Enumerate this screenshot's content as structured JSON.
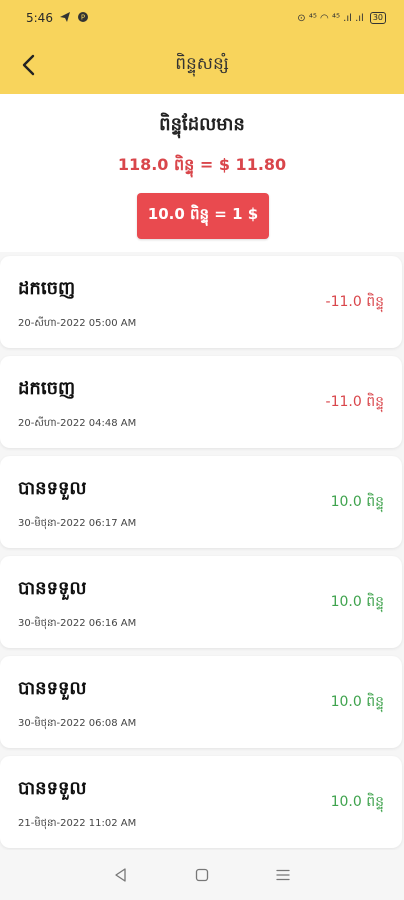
{
  "status_bar": {
    "time": "5:46",
    "left_glyphs": [
      "telegram-icon",
      "app-icon"
    ],
    "right_glyphs": "⊙ ⁴⁵ ◠ ⁴⁵ .ıl .ıl",
    "battery": "30"
  },
  "header": {
    "title": "ពិន្ទុសន្សំ",
    "back_icon": "arrow-left-icon"
  },
  "summary": {
    "label": "ពិន្ទុដែលមាន",
    "balance": "118.0 ពិន្ទុ = $ 11.80",
    "rate_button": "10.0 ពិន្ទុ = 1 $"
  },
  "colors": {
    "header_bg": "#f8d45c",
    "accent_red": "#e94a4f",
    "negative": "#d9464b",
    "positive": "#3fa34d"
  },
  "transactions": [
    {
      "title": "ដកចេញ",
      "date": "20-សីហា-2022  05:00 AM",
      "amount": "-11.0 ពិន្ទុ",
      "type": "out"
    },
    {
      "title": "ដកចេញ",
      "date": "20-សីហា-2022  04:48 AM",
      "amount": "-11.0 ពិន្ទុ",
      "type": "out"
    },
    {
      "title": "បានទទួល",
      "date": "30-មិថុនា-2022  06:17 AM",
      "amount": "10.0 ពិន្ទុ",
      "type": "in"
    },
    {
      "title": "បានទទួល",
      "date": "30-មិថុនា-2022  06:16 AM",
      "amount": "10.0 ពិន្ទុ",
      "type": "in"
    },
    {
      "title": "បានទទួល",
      "date": "30-មិថុនា-2022  06:08 AM",
      "amount": "10.0 ពិន្ទុ",
      "type": "in"
    },
    {
      "title": "បានទទួល",
      "date": "21-មិថុនា-2022  11:02 AM",
      "amount": "10.0 ពិន្ទុ",
      "type": "in"
    }
  ],
  "nav": {
    "back": "nav-back-icon",
    "home": "nav-home-icon",
    "menu": "nav-menu-icon"
  }
}
